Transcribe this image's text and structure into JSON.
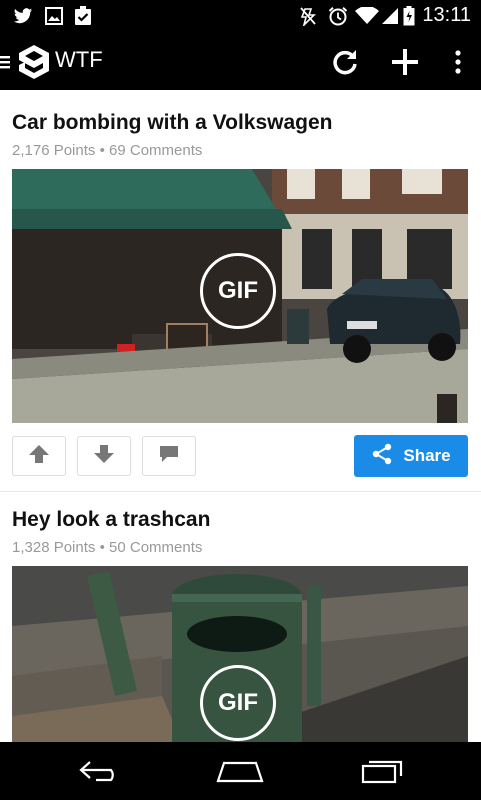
{
  "status_bar": {
    "time": "13:11",
    "icons": [
      "twitter-icon",
      "image-icon",
      "clipboard-check-icon",
      "mute-icon",
      "alarm-icon",
      "wifi-icon",
      "signal-icon",
      "battery-icon"
    ]
  },
  "app_bar": {
    "title": "WTF",
    "icons": [
      "menu-icon",
      "ninegag-logo",
      "refresh-icon",
      "add-icon",
      "overflow-menu-icon"
    ]
  },
  "posts": [
    {
      "title": "Car bombing with a Volkswagen",
      "points": "2,176 Points",
      "separator": "•",
      "comments": "69 Comments",
      "badge": "GIF",
      "share_label": "Share"
    },
    {
      "title": "Hey look a trashcan",
      "points": "1,328 Points",
      "separator": "•",
      "comments": "50 Comments",
      "badge": "GIF"
    }
  ],
  "nav_bar": {
    "icons": [
      "back-icon",
      "home-icon",
      "recent-apps-icon"
    ]
  },
  "colors": {
    "share_button": "#1a8ce8",
    "meta_text": "#999999",
    "title_text": "#111111",
    "bars": "#000000"
  }
}
